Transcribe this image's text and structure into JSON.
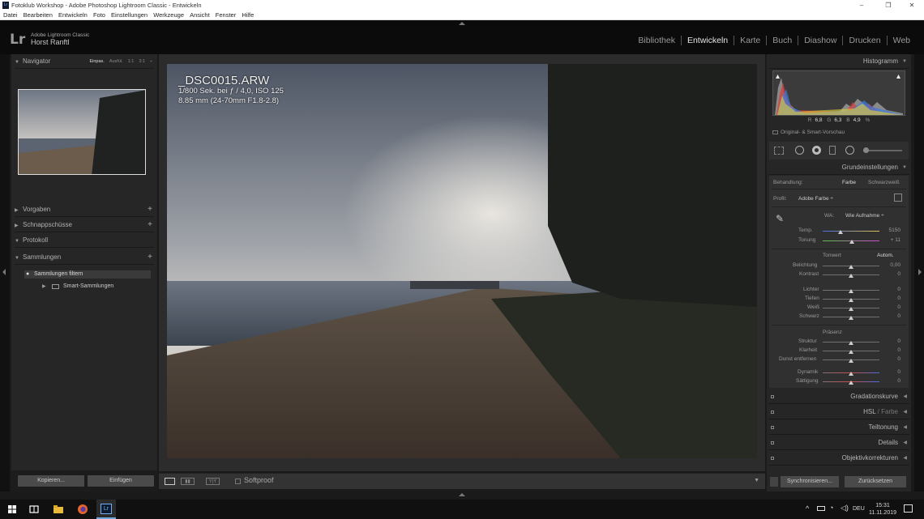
{
  "window": {
    "title": "Fotoklub Workshop - Adobe Photoshop Lightroom Classic - Entwickeln"
  },
  "menu": [
    "Datei",
    "Bearbeiten",
    "Entwickeln",
    "Foto",
    "Einstellungen",
    "Werkzeuge",
    "Ansicht",
    "Fenster",
    "Hilfe"
  ],
  "identity": {
    "logo": "Lr",
    "product": "Adobe Lightroom Classic",
    "user": "Horst Ranftl"
  },
  "modules": [
    "Bibliothek",
    "Entwickeln",
    "Karte",
    "Buch",
    "Diashow",
    "Drucken",
    "Web"
  ],
  "active_module": "Entwickeln",
  "navigator": {
    "title": "Navigator",
    "zoom": [
      "Einpas.",
      "Ausfül.",
      "1:1",
      "3:1"
    ]
  },
  "left_panels": {
    "presets": "Vorgaben",
    "snapshots": "Schnappschüsse",
    "history": "Protokoll",
    "collections": "Sammlungen",
    "filter": "Sammlungen filtern",
    "smart": "Smart-Sammlungen"
  },
  "left_buttons": {
    "copy": "Kopieren...",
    "paste": "Einfügen"
  },
  "photo": {
    "filename": "_DSC0015.ARW",
    "exposure": "1/800 Sek. bei ƒ / 4,0, ISO 125",
    "lens": "8.85 mm (24-70mm F1.8-2.8)"
  },
  "toolbar": {
    "softproof": "Softproof"
  },
  "histogram": {
    "title": "Histogramm",
    "r_label": "R",
    "r": "6,8",
    "g_label": "G",
    "g": "6,3",
    "b_label": "B",
    "b": "4,9",
    "unit": "%",
    "smart_preview": "Original- & Smart-Vorschau"
  },
  "basic": {
    "title": "Grundeinstellungen",
    "treatment_label": "Behandlung:",
    "treatment_color": "Farbe",
    "treatment_bw": "Schwarzweiß",
    "profile_label": "Profil:",
    "profile": "Adobe Farbe ÷",
    "wb_label": "WA:",
    "wb": "Wie Aufnahme ÷",
    "temp_label": "Temp.",
    "temp": "5150",
    "tint_label": "Tonung",
    "tint": "+ 11",
    "tone_label": "Tonwert",
    "auto": "Autom.",
    "exposure_label": "Belichtung",
    "exposure": "0,00",
    "contrast_label": "Kontrast",
    "contrast": "0",
    "highlights_label": "Lichter",
    "highlights": "0",
    "shadows_label": "Tiefen",
    "shadows": "0",
    "whites_label": "Weiß",
    "whites": "0",
    "blacks_label": "Schwarz",
    "blacks": "0",
    "presence_label": "Präsenz",
    "texture_label": "Struktur",
    "texture": "0",
    "clarity_label": "Klarheit",
    "clarity": "0",
    "dehaze_label": "Dunst entfernen",
    "dehaze": "0",
    "vibrance_label": "Dynamik",
    "vibrance": "0",
    "saturation_label": "Sättigung",
    "saturation": "0"
  },
  "right_panels": {
    "curve": "Gradationskurve",
    "hsl": "HSL",
    "hsl_color": "/ Farbe",
    "split": "Teiltonung",
    "details": "Details",
    "lens": "Objektivkorrekturen"
  },
  "right_buttons": {
    "sync": "Synchronisieren...",
    "reset": "Zurücksetzen"
  },
  "taskbar": {
    "lang": "DEU",
    "time": "15:31",
    "date": "11.11.2019"
  }
}
